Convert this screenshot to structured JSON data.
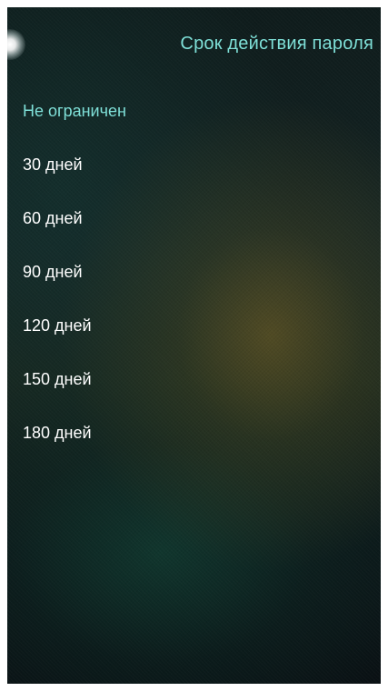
{
  "header": {
    "title": "Срок действия пароля"
  },
  "options": {
    "selected_index": 0,
    "items": [
      {
        "label": "Не ограничен"
      },
      {
        "label": "30 дней"
      },
      {
        "label": "60 дней"
      },
      {
        "label": "90 дней"
      },
      {
        "label": "120 дней"
      },
      {
        "label": "150 дней"
      },
      {
        "label": "180 дней"
      }
    ]
  },
  "colors": {
    "accent": "#7fe0d8",
    "text": "#ffffff",
    "frame": "#ffffff"
  }
}
